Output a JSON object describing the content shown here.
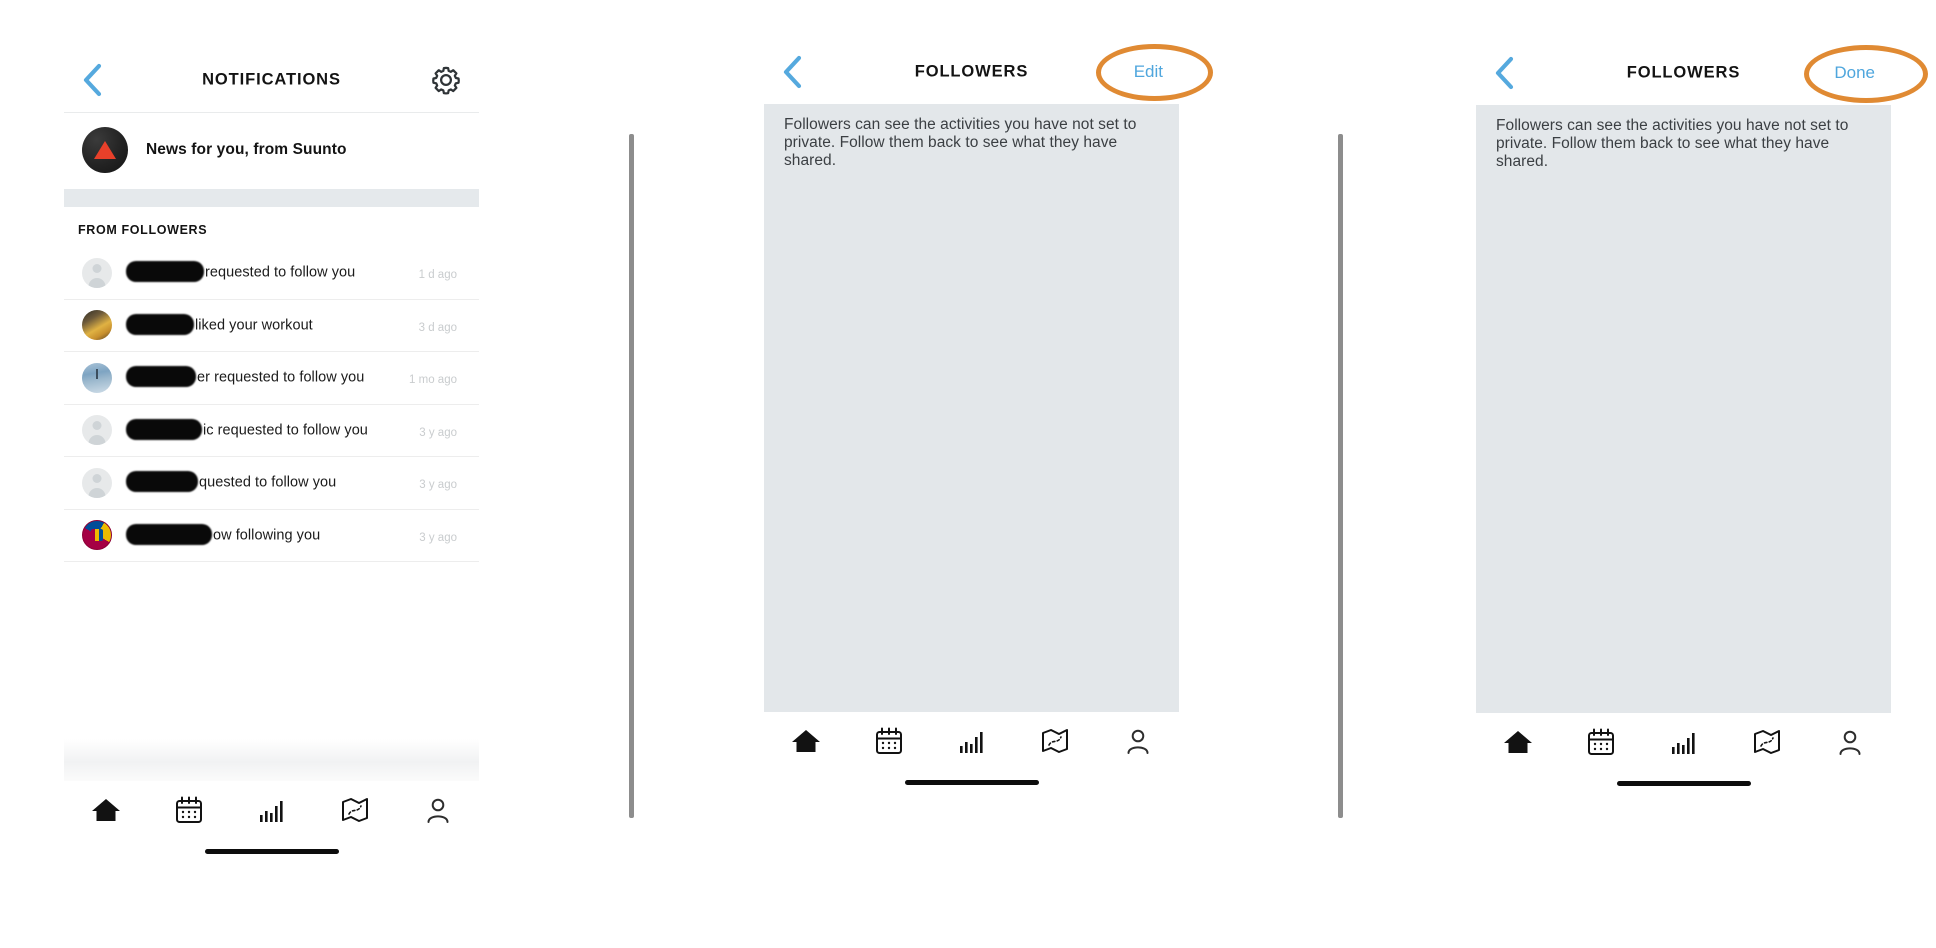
{
  "accent": {
    "ios_blue": "#4fa6dd",
    "highlight_orange": "#e08a33",
    "suunto_red": "#e8402a",
    "gray_panel": "#e3e7ea"
  },
  "panel_notifications": {
    "nav": {
      "back_icon": "chevron-left-icon",
      "title": "NOTIFICATIONS",
      "settings_icon": "gear-icon"
    },
    "news_row": {
      "avatar_icon": "suunto-logo-avatar",
      "label": "News for you, from Suunto"
    },
    "section_label": "FROM FOLLOWERS",
    "items": [
      {
        "avatar": "blank-person-avatar",
        "redacted_width": 78,
        "text": "requested to follow you",
        "time": "1 d ago"
      },
      {
        "avatar": "food-photo-avatar",
        "redacted_width": 68,
        "text": "liked your workout",
        "time": "3 d ago"
      },
      {
        "avatar": "water-photo-avatar",
        "redacted_width": 70,
        "text": "er requested to follow you",
        "time": "1 mo ago"
      },
      {
        "avatar": "blank-person-avatar",
        "redacted_width": 76,
        "text": "ic requested to follow you",
        "time": "3 y ago"
      },
      {
        "avatar": "blank-person-avatar",
        "redacted_width": 72,
        "text": "quested to follow you",
        "time": "3 y ago"
      },
      {
        "avatar": "barca-crest-avatar",
        "redacted_width": 86,
        "text": "ow following you",
        "time": "3 y ago"
      }
    ]
  },
  "panel_followers_view": {
    "nav": {
      "back_icon": "chevron-left-icon",
      "title": "FOLLOWERS",
      "action_label": "Edit"
    },
    "info_text": "Followers can see the activities you have not set to private. Follow them back to see what they have shared."
  },
  "panel_followers_edit": {
    "nav": {
      "back_icon": "chevron-left-icon",
      "title": "FOLLOWERS",
      "action_label": "Done"
    },
    "info_text": "Followers can see the activities you have not set to private. Follow them back to see what they have shared."
  },
  "tabbar": {
    "items": [
      {
        "icon": "home-icon",
        "active": true
      },
      {
        "icon": "calendar-icon",
        "active": false
      },
      {
        "icon": "bar-chart-icon",
        "active": false
      },
      {
        "icon": "map-icon",
        "active": false
      },
      {
        "icon": "person-icon",
        "active": false
      }
    ]
  }
}
